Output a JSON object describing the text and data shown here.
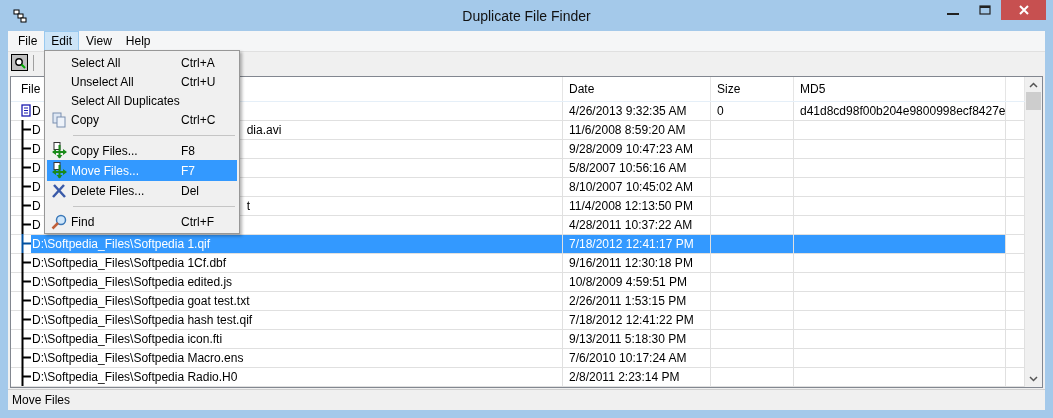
{
  "window": {
    "title": "Duplicate File Finder"
  },
  "menu_bar": [
    {
      "label": "File",
      "selected": false
    },
    {
      "label": "Edit",
      "selected": true
    },
    {
      "label": "View",
      "selected": false
    },
    {
      "label": "Help",
      "selected": false
    }
  ],
  "edit_menu": [
    {
      "kind": "plain",
      "label": "Select All",
      "shortcut": "Ctrl+A",
      "selected": false
    },
    {
      "kind": "plain",
      "label": "Unselect All",
      "shortcut": "Ctrl+U",
      "selected": false
    },
    {
      "kind": "plain",
      "label": "Select All Duplicates",
      "selected": false
    },
    {
      "kind": "copy",
      "label": "Copy",
      "shortcut": "Ctrl+C",
      "selected": false
    },
    {
      "kind": "separator"
    },
    {
      "kind": "duplicate",
      "label": "Copy Files...",
      "shortcut": "F8",
      "selected": false
    },
    {
      "kind": "move",
      "label": "Move Files...",
      "shortcut": "F7",
      "selected": true
    },
    {
      "kind": "delete",
      "label": "Delete Files...",
      "shortcut": "Del",
      "selected": false
    },
    {
      "kind": "separator"
    },
    {
      "kind": "find",
      "label": "Find",
      "shortcut": "Ctrl+F",
      "selected": false
    }
  ],
  "table": {
    "columns": [
      "File",
      "Date",
      "Size",
      "MD5"
    ],
    "rows": [
      {
        "name": "D",
        "date": "4/26/2013 9:32:35 AM",
        "size": "0",
        "md5": "d41d8cd98f00b204e9800998ecf8427e",
        "selected": false,
        "children": [
          {
            "name": "D",
            "name_end": "dia.avi",
            "date": "11/6/2008 8:59:20 AM",
            "selected": false
          },
          {
            "name": "D",
            "date": "9/28/2009 10:47:23 AM",
            "selected": false
          },
          {
            "name": "D",
            "date": "5/8/2007 10:56:16 AM",
            "selected": false
          },
          {
            "name": "D",
            "date": "8/10/2007 10:45:02 AM",
            "selected": false
          },
          {
            "name": "D",
            "name_end": "t",
            "date": "11/4/2008 12:13:50 PM",
            "selected": false
          },
          {
            "name": "D",
            "date": "4/28/2011 10:37:22 AM",
            "selected": false
          },
          {
            "name": "D:\\Softpedia_Files\\Softpedia 1.qif",
            "date": "7/18/2012 12:41:17 PM",
            "selected": true
          },
          {
            "name": "D:\\Softpedia_Files\\Softpedia 1Cf.dbf",
            "date": "9/16/2011 12:30:18 PM",
            "selected": false
          },
          {
            "name": "D:\\Softpedia_Files\\Softpedia edited.js",
            "date": "10/8/2009 4:59:51 PM",
            "selected": false
          },
          {
            "name": "D:\\Softpedia_Files\\Softpedia goat test.txt",
            "date": "2/26/2011 1:53:15 PM",
            "selected": false
          },
          {
            "name": "D:\\Softpedia_Files\\Softpedia hash test.qif",
            "date": "7/18/2012 12:41:22 PM",
            "selected": false
          },
          {
            "name": "D:\\Softpedia_Files\\Softpedia icon.fti",
            "date": "9/13/2011 5:18:30 PM",
            "selected": false
          },
          {
            "name": "D:\\Softpedia_Files\\Softpedia Macro.ens",
            "date": "7/6/2010 10:17:24 AM",
            "selected": false
          },
          {
            "name": "D:\\Softpedia_Files\\Softpedia Radio.H0",
            "date": "2/8/2011 2:23:14 PM",
            "selected": false
          }
        ]
      }
    ]
  },
  "status_bar": "Move Files"
}
